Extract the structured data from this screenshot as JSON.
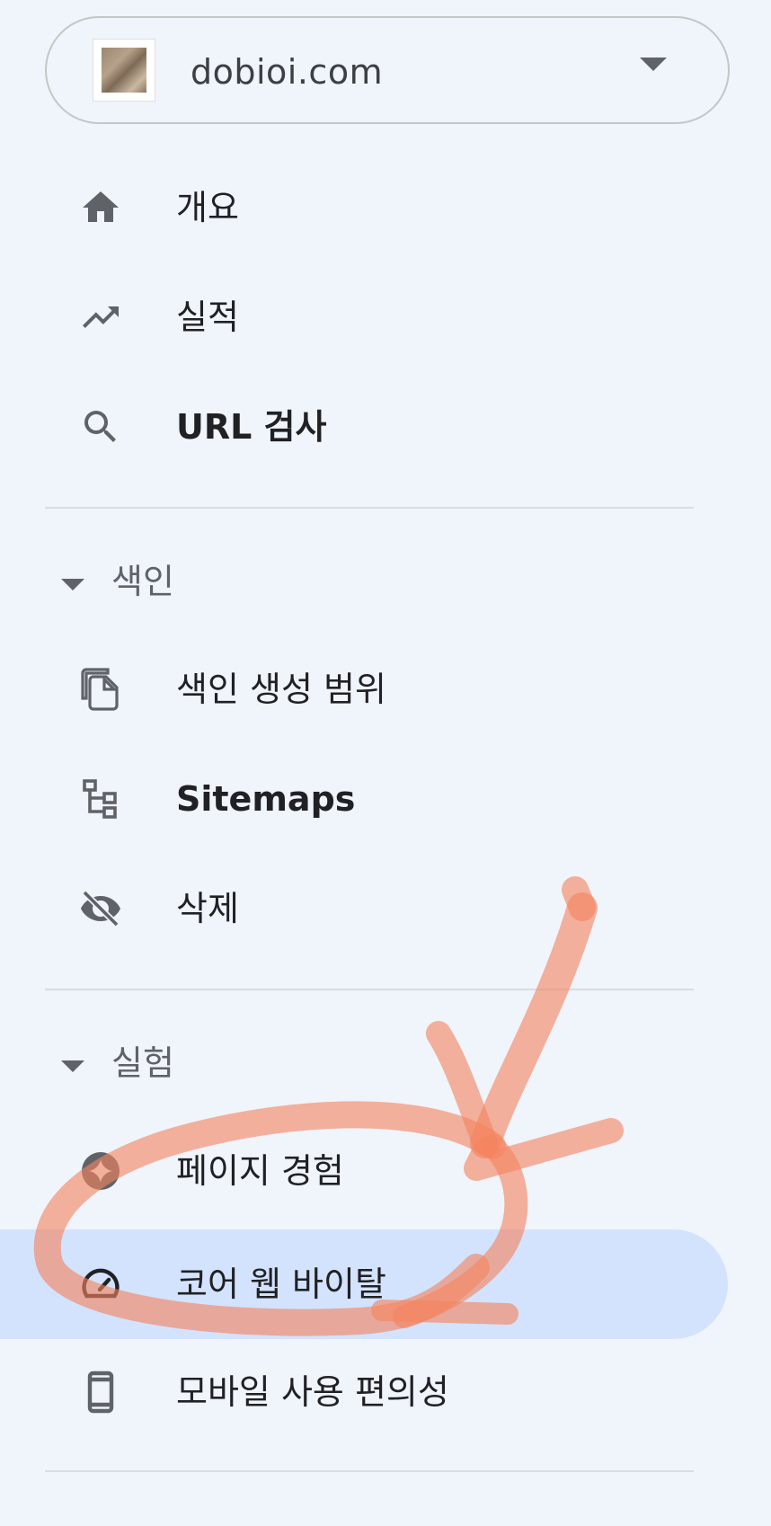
{
  "property": {
    "domain": "dobioi.com",
    "favicon_icon": "site-favicon",
    "dropdown_icon": "caret-down-icon"
  },
  "nav": {
    "overview": {
      "label": "개요",
      "icon": "home-icon"
    },
    "performance": {
      "label": "실적",
      "icon": "trending-up-icon"
    },
    "url_inspection": {
      "label": "URL 검사",
      "icon": "search-icon"
    }
  },
  "sections": {
    "indexing": {
      "title": "색인",
      "items": [
        {
          "label": "색인 생성 범위",
          "icon": "copy-pages-icon"
        },
        {
          "label": "Sitemaps",
          "icon": "sitemap-icon"
        },
        {
          "label": "삭제",
          "icon": "eye-off-icon"
        }
      ]
    },
    "experience": {
      "title": "실험",
      "items": [
        {
          "label": "페이지 경험",
          "icon": "sparkle-badge-icon"
        },
        {
          "label": "코어 웹 바이탈",
          "icon": "speedometer-icon",
          "active": true
        },
        {
          "label": "모바일 사용 편의성",
          "icon": "smartphone-icon"
        }
      ]
    }
  },
  "colors": {
    "background": "#f0f4fb",
    "active_item": "#d3e3fd",
    "icon": "#5f6368",
    "annotation": "#f4845f"
  }
}
